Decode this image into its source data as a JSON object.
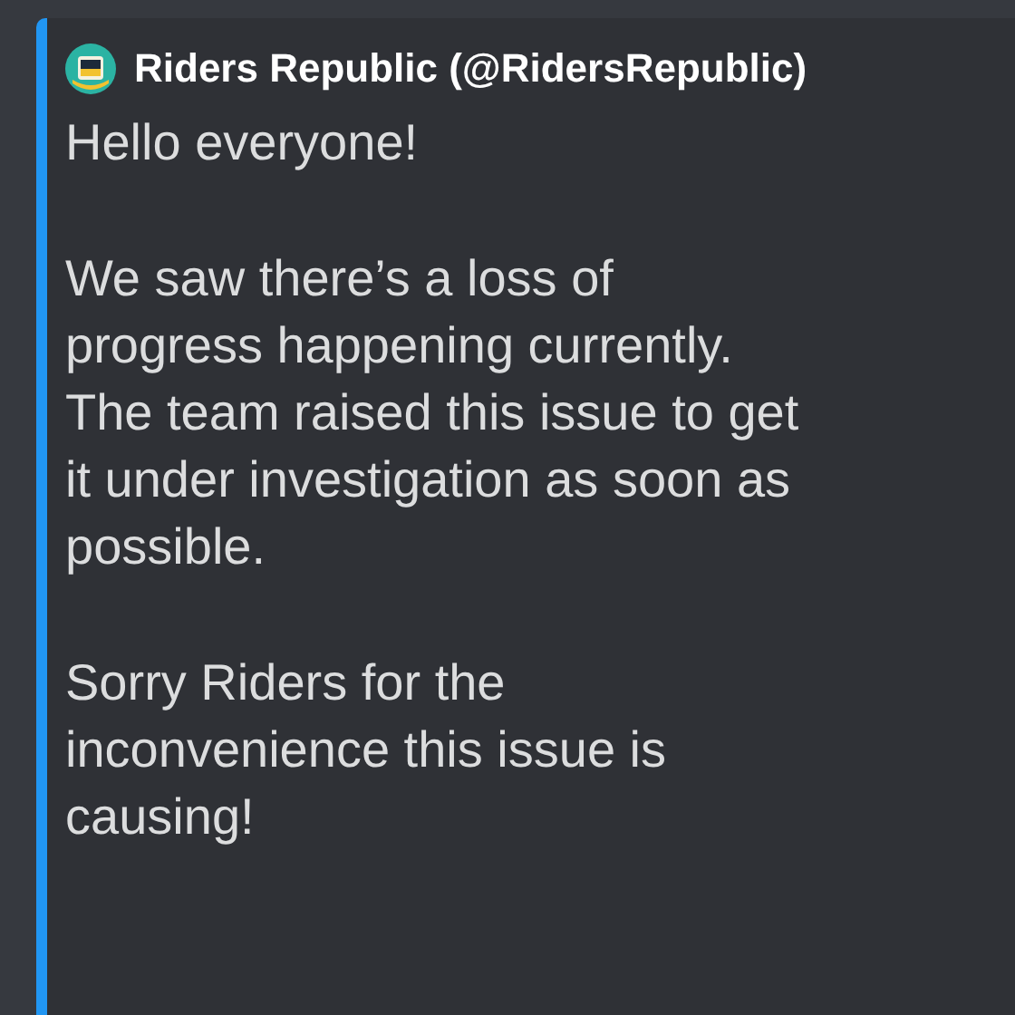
{
  "embed": {
    "author": "Riders Republic (@RidersRepublic)",
    "paragraphs": [
      [
        "Hello everyone!"
      ],
      [
        "We saw there’s a loss of",
        "progress happening currently.",
        "The team raised this issue to get",
        "it under investigation as soon as",
        "possible."
      ],
      [
        "Sorry Riders for the",
        "inconvenience this issue is",
        "causing!"
      ]
    ]
  }
}
